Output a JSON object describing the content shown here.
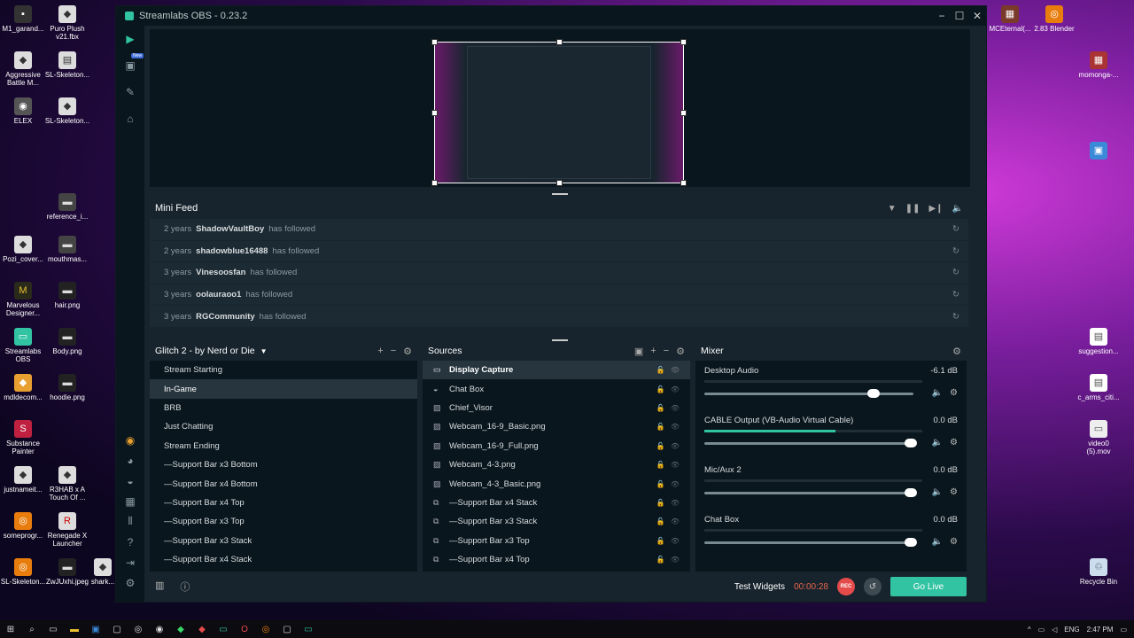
{
  "desktop": {
    "left_icons": [
      {
        "label": "M1_garand..."
      },
      {
        "label": "Puro Plush v21.fbx"
      },
      {
        "label": "Aggressive Battle M..."
      },
      {
        "label": "SL-Skeleton..."
      },
      {
        "label": "ELEX"
      },
      {
        "label": "SL-Skeleton..."
      },
      {
        "label": "reference_i..."
      },
      {
        "label": "Pozi_cover..."
      },
      {
        "label": "mouthmas..."
      },
      {
        "label": "Marvelous Designer..."
      },
      {
        "label": "hair.png"
      },
      {
        "label": "Streamlabs OBS"
      },
      {
        "label": "Body.png"
      },
      {
        "label": "mdldecom..."
      },
      {
        "label": "hoodie.png"
      },
      {
        "label": "Substance Painter"
      },
      {
        "label": "justnameit..."
      },
      {
        "label": "R3HAB x A Touch Of ..."
      },
      {
        "label": "someprogr..."
      },
      {
        "label": "Renegade X Launcher"
      },
      {
        "label": "SL-Skeleton..."
      },
      {
        "label": "ZwJUxhi.jpeg"
      },
      {
        "label": "shark..."
      }
    ],
    "right_icons": [
      {
        "label": "MCEternal(..."
      },
      {
        "label": "2.83 Blender"
      },
      {
        "label": "momonga-..."
      },
      {
        "label": "suggestion..."
      },
      {
        "label": "c_arms_citi..."
      },
      {
        "label": "video0 (5).mov"
      },
      {
        "label": "Recycle Bin"
      }
    ]
  },
  "window": {
    "title": "Streamlabs OBS - 0.23.2"
  },
  "nav": {
    "new_badge": "New"
  },
  "minifeed": {
    "title": "Mini Feed",
    "rows": [
      {
        "time": "2 years",
        "user": "ShadowVaultBoy",
        "action": "has followed"
      },
      {
        "time": "2 years",
        "user": "shadowblue16488",
        "action": "has followed"
      },
      {
        "time": "3 years",
        "user": "Vinesoosfan",
        "action": "has followed"
      },
      {
        "time": "3 years",
        "user": "oolauraoo1",
        "action": "has followed"
      },
      {
        "time": "3 years",
        "user": "RGCommunity",
        "action": "has followed"
      }
    ]
  },
  "scenes": {
    "collection": "Glitch 2 - by Nerd or Die",
    "items": [
      "Stream Starting",
      "In-Game",
      "BRB",
      "Just Chatting",
      "Stream Ending",
      "—Support Bar x3 Bottom",
      "—Support Bar x4 Bottom",
      "—Support Bar x4 Top",
      "—Support Bar x3 Top",
      "—Support Bar x3 Stack",
      "—Support Bar x4 Stack"
    ],
    "selected": 1
  },
  "sources": {
    "title": "Sources",
    "items": [
      {
        "icon": "monitor-icon",
        "glyph": "▭",
        "label": "Display Capture"
      },
      {
        "icon": "chat-icon",
        "glyph": "◒",
        "label": "Chat Box"
      },
      {
        "icon": "image-icon",
        "glyph": "▨",
        "label": "Chief_Visor"
      },
      {
        "icon": "image-icon",
        "glyph": "▨",
        "label": "Webcam_16-9_Basic.png"
      },
      {
        "icon": "image-icon",
        "glyph": "▨",
        "label": "Webcam_16-9_Full.png"
      },
      {
        "icon": "image-icon",
        "glyph": "▨",
        "label": "Webcam_4-3.png"
      },
      {
        "icon": "image-icon",
        "glyph": "▨",
        "label": "Webcam_4-3_Basic.png"
      },
      {
        "icon": "group-icon",
        "glyph": "⧉",
        "label": "—Support Bar x4 Stack"
      },
      {
        "icon": "group-icon",
        "glyph": "⧉",
        "label": "—Support Bar x3 Stack"
      },
      {
        "icon": "group-icon",
        "glyph": "⧉",
        "label": "—Support Bar x3 Top"
      },
      {
        "icon": "group-icon",
        "glyph": "⧉",
        "label": "—Support Bar x4 Top"
      }
    ]
  },
  "mixer": {
    "title": "Mixer",
    "channels": [
      {
        "name": "Desktop Audio",
        "db": "-6.1 dB",
        "level": 0.0,
        "volume": 0.82
      },
      {
        "name": "CABLE Output (VB-Audio Virtual Cable)",
        "db": "0.0 dB",
        "level": 0.6,
        "volume": 1.0
      },
      {
        "name": "Mic/Aux 2",
        "db": "0.0 dB",
        "level": 0.0,
        "volume": 1.0
      },
      {
        "name": "Chat Box",
        "db": "0.0 dB",
        "level": 0.0,
        "volume": 1.0
      }
    ]
  },
  "footer": {
    "test_widgets": "Test Widgets",
    "timer": "00:00:28",
    "rec": "REC",
    "go_live": "Go Live"
  },
  "taskbar": {
    "lang": "ENG",
    "time": "2:47 PM"
  },
  "colors": {
    "accent": "#31c3a2",
    "rec": "#e54b4b",
    "timer": "#e5644b"
  }
}
